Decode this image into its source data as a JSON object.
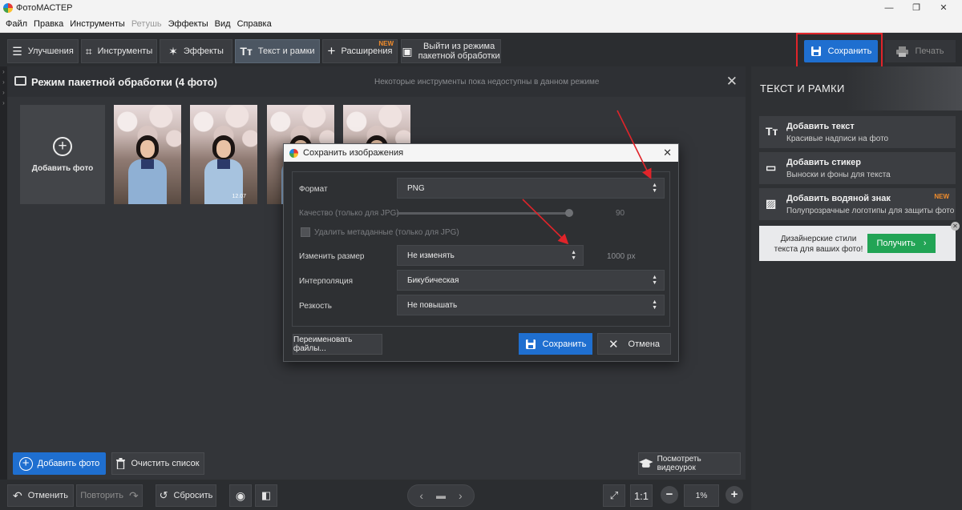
{
  "app": {
    "title": "ФотоМАСТЕР",
    "window_controls": [
      "—",
      "❐",
      "✕"
    ]
  },
  "menu": [
    {
      "label": "Файл",
      "enabled": true
    },
    {
      "label": "Правка",
      "enabled": true
    },
    {
      "label": "Инструменты",
      "enabled": true
    },
    {
      "label": "Ретушь",
      "enabled": false
    },
    {
      "label": "Эффекты",
      "enabled": true
    },
    {
      "label": "Вид",
      "enabled": true
    },
    {
      "label": "Справка",
      "enabled": true
    }
  ],
  "toolbar": {
    "tabs": [
      {
        "label": "Улучшения",
        "icon": "sliders-icon"
      },
      {
        "label": "Инструменты",
        "icon": "crop-icon"
      },
      {
        "label": "Эффекты",
        "icon": "magic-wand-icon"
      },
      {
        "label": "Текст и рамки",
        "icon": "text-icon",
        "active": true
      },
      {
        "label": "Расширения",
        "icon": "plus-icon",
        "badge": "NEW"
      },
      {
        "label": "Выйти из режима\nпакетной обработки",
        "icon": "image-icon"
      }
    ],
    "save_label": "Сохранить",
    "print_label": "Печать"
  },
  "main": {
    "title": "Режим пакетной обработки (4 фото)",
    "note": "Некоторые инструменты пока недоступны в данном режиме",
    "add_photo_card": "Добавить фото",
    "thumb_stamp": "12.07",
    "add_photo_button": "Добавить фото",
    "clear_list_button": "Очистить список",
    "video_button": "Посмотреть видеоурок"
  },
  "bottom": {
    "undo": "Отменить",
    "redo": "Повторить",
    "reset": "Сбросить",
    "ratio": "1:1",
    "zoom": "1%"
  },
  "right_panel": {
    "title": "ТЕКСТ И РАМКИ",
    "items": [
      {
        "title": "Добавить текст",
        "subtitle": "Красивые надписи на фото",
        "icon": "text-tool-icon"
      },
      {
        "title": "Добавить стикер",
        "subtitle": "Выноски и фоны для текста",
        "icon": "sticker-icon"
      },
      {
        "title": "Добавить водяной знак",
        "subtitle": "Полупрозрачные логотипы для защиты фото",
        "icon": "watermark-icon",
        "badge": "NEW"
      }
    ],
    "promo": {
      "text": "Дизайнерские стили текста для ваших фото!",
      "button": "Получить"
    }
  },
  "dialog": {
    "title": "Сохранить изображения",
    "format_label": "Формат",
    "format_value": "PNG",
    "quality_label": "Качество (только для JPG)",
    "quality_value": "90",
    "metadata_label": "Удалить метаданные (только для JPG)",
    "resize_label": "Изменить размер",
    "resize_value": "Не изменять",
    "resize_px": "1000 px",
    "interp_label": "Интерполяция",
    "interp_value": "Бикубическая",
    "sharp_label": "Резкость",
    "sharp_value": "Не повышать",
    "rename_button": "Переименовать файлы...",
    "save_button": "Сохранить",
    "cancel_button": "Отмена"
  },
  "colors": {
    "accent": "#1f6fd0",
    "highlight": "#e0242a",
    "badge": "#f08c2c",
    "promo_button": "#22a455"
  }
}
